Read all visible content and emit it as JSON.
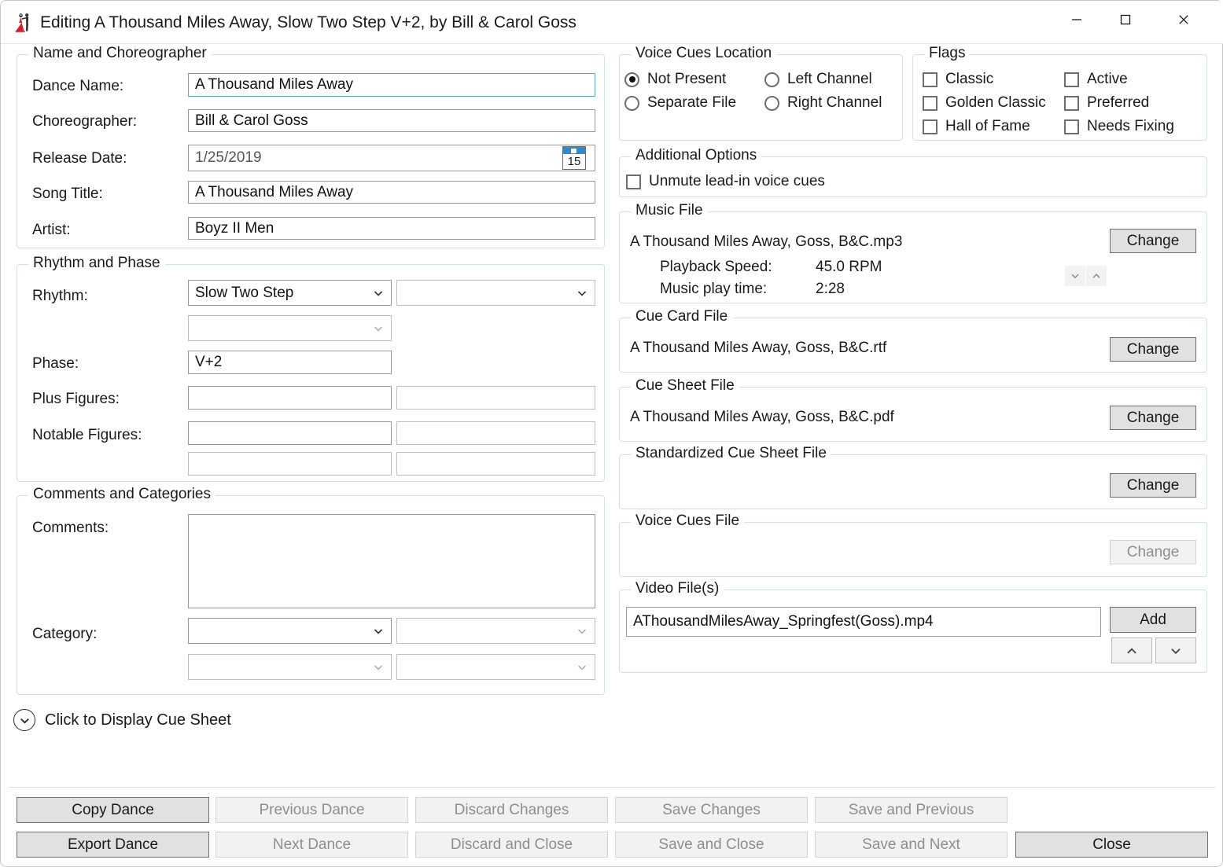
{
  "window": {
    "title": "Editing A Thousand Miles Away, Slow Two Step V+2, by Bill & Carol Goss",
    "icon": "dancers-icon",
    "controls": {
      "minimize": "minimize-icon",
      "maximize": "maximize-icon",
      "close": "close-icon"
    }
  },
  "name_group": {
    "legend": "Name and Choreographer",
    "fields": [
      {
        "label": "Dance Name:",
        "value": "A Thousand Miles Away"
      },
      {
        "label": "Choreographer:",
        "value": "Bill & Carol Goss"
      },
      {
        "label": "Release Date:",
        "value": "1/25/2019"
      },
      {
        "label": "Song Title:",
        "value": "A Thousand Miles Away"
      },
      {
        "label": "Artist:",
        "value": "Boyz II Men"
      }
    ],
    "calendar_day": "15"
  },
  "rhythm_group": {
    "legend": "Rhythm and Phase",
    "rhythm_label": "Rhythm:",
    "rhythm_value": "Slow Two Step",
    "rhythm_alt_value": "",
    "rhythm_third_value": "",
    "phase_label": "Phase:",
    "phase_value": "V+2",
    "plus_label": "Plus Figures:",
    "plus_value": "",
    "plus_value2": "",
    "notable_label": "Notable Figures:",
    "notable_value": "",
    "notable_value2": "",
    "notable_value3": "",
    "notable_value4": ""
  },
  "comments_group": {
    "legend": "Comments and Categories",
    "comments_label": "Comments:",
    "comments_value": "",
    "category_label": "Category:",
    "cat1": "",
    "cat2": "",
    "cat3": "",
    "cat4": ""
  },
  "voice_cues_location": {
    "legend": "Voice Cues Location",
    "options": [
      {
        "label": "Not Present",
        "selected": true
      },
      {
        "label": "Left Channel",
        "selected": false
      },
      {
        "label": "Separate File",
        "selected": false
      },
      {
        "label": "Right Channel",
        "selected": false
      }
    ]
  },
  "flags": {
    "legend": "Flags",
    "items": [
      {
        "label": "Classic",
        "checked": false
      },
      {
        "label": "Active",
        "checked": false
      },
      {
        "label": "Golden Classic",
        "checked": false
      },
      {
        "label": "Preferred",
        "checked": false
      },
      {
        "label": "Hall of Fame",
        "checked": false
      },
      {
        "label": "Needs Fixing",
        "checked": false
      }
    ]
  },
  "additional_options": {
    "legend": "Additional Options",
    "unmute_label": "Unmute lead-in voice cues",
    "unmute_checked": false
  },
  "music_file": {
    "legend": "Music File",
    "filename": "A Thousand Miles Away, Goss, B&C.mp3",
    "playback_speed_label": "Playback Speed:",
    "playback_speed_value": "45.0 RPM",
    "play_time_label": "Music play time:",
    "play_time_value": "2:28",
    "change_label": "Change",
    "spin_down": "chevron-down-icon",
    "spin_up": "chevron-up-icon"
  },
  "cue_card_file": {
    "legend": "Cue Card File",
    "filename": "A Thousand Miles Away, Goss, B&C.rtf",
    "change_label": "Change"
  },
  "cue_sheet_file": {
    "legend": "Cue Sheet File",
    "filename": "A Thousand Miles Away, Goss, B&C.pdf",
    "change_label": "Change"
  },
  "standardized_cue_sheet_file": {
    "legend": "Standardized Cue Sheet File",
    "filename": "",
    "change_label": "Change"
  },
  "voice_cues_file": {
    "legend": "Voice Cues File",
    "filename": "",
    "change_label": "Change",
    "change_disabled": true
  },
  "video_files": {
    "legend": "Video File(s)",
    "items": [
      "AThousandMilesAway_Springfest(Goss).mp4"
    ],
    "add_label": "Add",
    "move_up": "chevron-up-icon",
    "move_down": "chevron-down-icon"
  },
  "cue_sheet_toggle": {
    "label": "Click to Display Cue Sheet",
    "icon": "chevron-down-circle-icon"
  },
  "footer_buttons": {
    "row1": [
      {
        "label": "Copy Dance",
        "enabled": true
      },
      {
        "label": "Previous Dance",
        "enabled": false
      },
      {
        "label": "Discard Changes",
        "enabled": false
      },
      {
        "label": "Save Changes",
        "enabled": false
      },
      {
        "label": "Save and Previous",
        "enabled": false
      }
    ],
    "row2": [
      {
        "label": "Export Dance",
        "enabled": true
      },
      {
        "label": "Next Dance",
        "enabled": false
      },
      {
        "label": "Discard and Close",
        "enabled": false
      },
      {
        "label": "Save and Close",
        "enabled": false
      },
      {
        "label": "Save and Next",
        "enabled": false
      },
      {
        "label": "Close",
        "enabled": true
      }
    ]
  },
  "colors": {
    "accent_focus": "#5aa7e0",
    "group_border": "#d7dee5",
    "icon_red": "#d1222b",
    "calendar_header": "#2e8bd0"
  }
}
